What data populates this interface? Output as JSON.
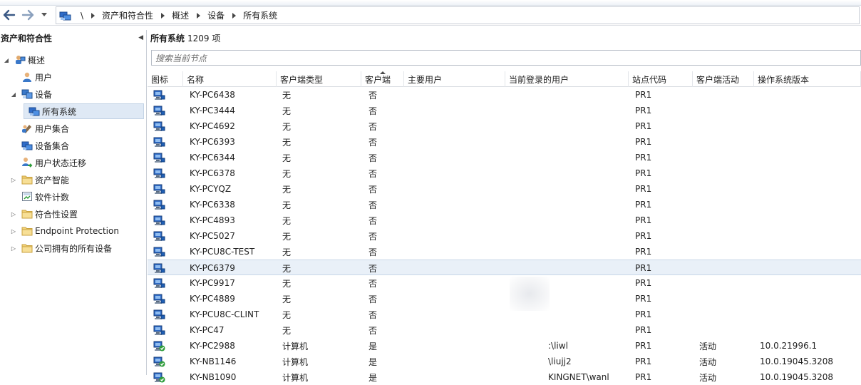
{
  "nav": {
    "breadcrumb": [
      "\\",
      "资产和符合性",
      "概述",
      "设备",
      "所有系统"
    ]
  },
  "left_pane": {
    "title": "资产和符合性",
    "tree": [
      {
        "label": "概述",
        "icon": "overview-icon",
        "level": 0,
        "expander": "expanded"
      },
      {
        "label": "用户",
        "icon": "user-icon",
        "level": 1,
        "expander": "none"
      },
      {
        "label": "设备",
        "icon": "devices-icon",
        "level": 1,
        "expander": "expanded"
      },
      {
        "label": "所有系统",
        "icon": "collection-icon",
        "level": 2,
        "expander": "none",
        "selected": true
      },
      {
        "label": "用户集合",
        "icon": "user-collection-icon",
        "level": 1,
        "expander": "none"
      },
      {
        "label": "设备集合",
        "icon": "device-collection-icon",
        "level": 1,
        "expander": "none"
      },
      {
        "label": "用户状态迁移",
        "icon": "user-migration-icon",
        "level": 1,
        "expander": "none"
      },
      {
        "label": "资产智能",
        "icon": "folder-icon",
        "level": 1,
        "expander": "collapsed"
      },
      {
        "label": "软件计数",
        "icon": "software-metering-icon",
        "level": 1,
        "expander": "none"
      },
      {
        "label": "符合性设置",
        "icon": "folder-icon",
        "level": 1,
        "expander": "collapsed"
      },
      {
        "label": "Endpoint Protection",
        "icon": "folder-icon",
        "level": 1,
        "expander": "collapsed"
      },
      {
        "label": "公司拥有的所有设备",
        "icon": "folder-icon",
        "level": 1,
        "expander": "collapsed"
      }
    ]
  },
  "main": {
    "title": "所有系统",
    "count": "1209 项",
    "search_placeholder": "搜索当前节点",
    "columns": [
      "图标",
      "名称",
      "客户端类型",
      "客户端",
      "主要用户",
      "当前登录的用户",
      "站点代码",
      "客户端活动",
      "操作系统版本"
    ],
    "rows": [
      {
        "name": "KY-PC6438",
        "type": "无",
        "client": "否",
        "primary": "",
        "logged": "",
        "site": "PR1",
        "active": "",
        "os": "",
        "managed": false
      },
      {
        "name": "KY-PC3444",
        "type": "无",
        "client": "否",
        "primary": "",
        "logged": "",
        "site": "PR1",
        "active": "",
        "os": "",
        "managed": false
      },
      {
        "name": "KY-PC4692",
        "type": "无",
        "client": "否",
        "primary": "",
        "logged": "",
        "site": "PR1",
        "active": "",
        "os": "",
        "managed": false
      },
      {
        "name": "KY-PC6393",
        "type": "无",
        "client": "否",
        "primary": "",
        "logged": "",
        "site": "PR1",
        "active": "",
        "os": "",
        "managed": false
      },
      {
        "name": "KY-PC6344",
        "type": "无",
        "client": "否",
        "primary": "",
        "logged": "",
        "site": "PR1",
        "active": "",
        "os": "",
        "managed": false
      },
      {
        "name": "KY-PC6378",
        "type": "无",
        "client": "否",
        "primary": "",
        "logged": "",
        "site": "PR1",
        "active": "",
        "os": "",
        "managed": false
      },
      {
        "name": "KY-PCYQZ",
        "type": "无",
        "client": "否",
        "primary": "",
        "logged": "",
        "site": "PR1",
        "active": "",
        "os": "",
        "managed": false
      },
      {
        "name": "KY-PC6338",
        "type": "无",
        "client": "否",
        "primary": "",
        "logged": "",
        "site": "PR1",
        "active": "",
        "os": "",
        "managed": false
      },
      {
        "name": "KY-PC4893",
        "type": "无",
        "client": "否",
        "primary": "",
        "logged": "",
        "site": "PR1",
        "active": "",
        "os": "",
        "managed": false
      },
      {
        "name": "KY-PC5027",
        "type": "无",
        "client": "否",
        "primary": "",
        "logged": "",
        "site": "PR1",
        "active": "",
        "os": "",
        "managed": false
      },
      {
        "name": "KY-PCU8C-TEST",
        "type": "无",
        "client": "否",
        "primary": "",
        "logged": "",
        "site": "PR1",
        "active": "",
        "os": "",
        "managed": false
      },
      {
        "name": "KY-PC6379",
        "type": "无",
        "client": "否",
        "primary": "",
        "logged": "",
        "site": "PR1",
        "active": "",
        "os": "",
        "managed": false,
        "selected": true
      },
      {
        "name": "KY-PC9917",
        "type": "无",
        "client": "否",
        "primary": "",
        "logged": "",
        "site": "PR1",
        "active": "",
        "os": "",
        "managed": false
      },
      {
        "name": "KY-PC4889",
        "type": "无",
        "client": "否",
        "primary": "",
        "logged": "",
        "site": "PR1",
        "active": "",
        "os": "",
        "managed": false
      },
      {
        "name": "KY-PCU8C-CLINT",
        "type": "无",
        "client": "否",
        "primary": "",
        "logged": "",
        "site": "PR1",
        "active": "",
        "os": "",
        "managed": false
      },
      {
        "name": "KY-PC47",
        "type": "无",
        "client": "否",
        "primary": "",
        "logged": "",
        "site": "PR1",
        "active": "",
        "os": "",
        "managed": false
      },
      {
        "name": "KY-PC2988",
        "type": "计算机",
        "client": "是",
        "primary": "",
        "logged": ":\\liwl",
        "site": "PR1",
        "active": "活动",
        "os": "10.0.21996.1",
        "managed": true
      },
      {
        "name": "KY-NB1146",
        "type": "计算机",
        "client": "是",
        "primary": "",
        "logged": "\\liujj2",
        "site": "PR1",
        "active": "活动",
        "os": "10.0.19045.3208",
        "managed": true
      },
      {
        "name": "KY-NB1090",
        "type": "计算机",
        "client": "是",
        "primary": "",
        "logged": "KINGNET\\wanl",
        "site": "PR1",
        "active": "活动",
        "os": "10.0.19045.3208",
        "managed": true
      }
    ]
  },
  "colors": {
    "selection": "#dfe9f5",
    "row_selection": "#e9f0f8",
    "border": "#c9ced6",
    "check_green": "#2e9d3a"
  }
}
